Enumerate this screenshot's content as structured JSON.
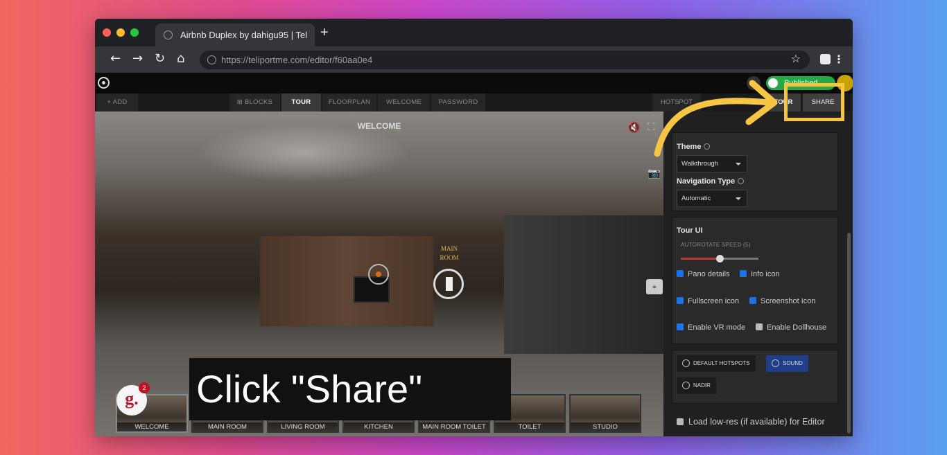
{
  "browser": {
    "tab_title": "Airbnb Duplex by dahigu95 | Tel",
    "new_tab": "+",
    "url": "https://teliportme.com/editor/f60aa0e4"
  },
  "app": {
    "publish_label": "Published",
    "add_label": "+ ADD",
    "main_tabs": [
      "BLOCKS",
      "TOUR",
      "FLOORPLAN",
      "WELCOME",
      "PASSWORD"
    ],
    "active_tab": "TOUR",
    "panel_tabs": [
      "HOTSPOT",
      "TOUR",
      "SHARE"
    ]
  },
  "viewer": {
    "title": "WELCOME",
    "hotspot_label_1": "MAIN",
    "hotspot_label_2": "ROOM",
    "badge_letter": "g.",
    "badge_count": "2",
    "thumbnails": [
      "WELCOME",
      "MAIN ROOM",
      "LIVING ROOM",
      "KITCHEN",
      "MAIN ROOM TOILET",
      "TOILET",
      "STUDIO"
    ]
  },
  "panel": {
    "theme_label": "Theme",
    "theme_value": "Walkthrough",
    "nav_label": "Navigation Type",
    "nav_value": "Automatic",
    "tour_ui_label": "Tour UI",
    "autorotate_label": "AUTOROTATE SPEED (5)",
    "autorotate_speed": 5,
    "checkboxes": [
      {
        "label": "Pano details",
        "checked": true
      },
      {
        "label": "Info icon",
        "checked": true
      },
      {
        "label": "Fullscreen icon",
        "checked": true
      },
      {
        "label": "Screenshot Icon",
        "checked": true
      },
      {
        "label": "Enable VR mode",
        "checked": true
      },
      {
        "label": "Enable Dollhouse",
        "checked": false
      }
    ],
    "default_hotspots": "DEFAULT HOTSPOTS",
    "sound": "SOUND",
    "nadir": "NADIR",
    "lowres_label": "Load low-res (if available) for Editor"
  },
  "annotation": {
    "caption": "Click \"Share\"",
    "highlight_color": "#f6c543"
  }
}
